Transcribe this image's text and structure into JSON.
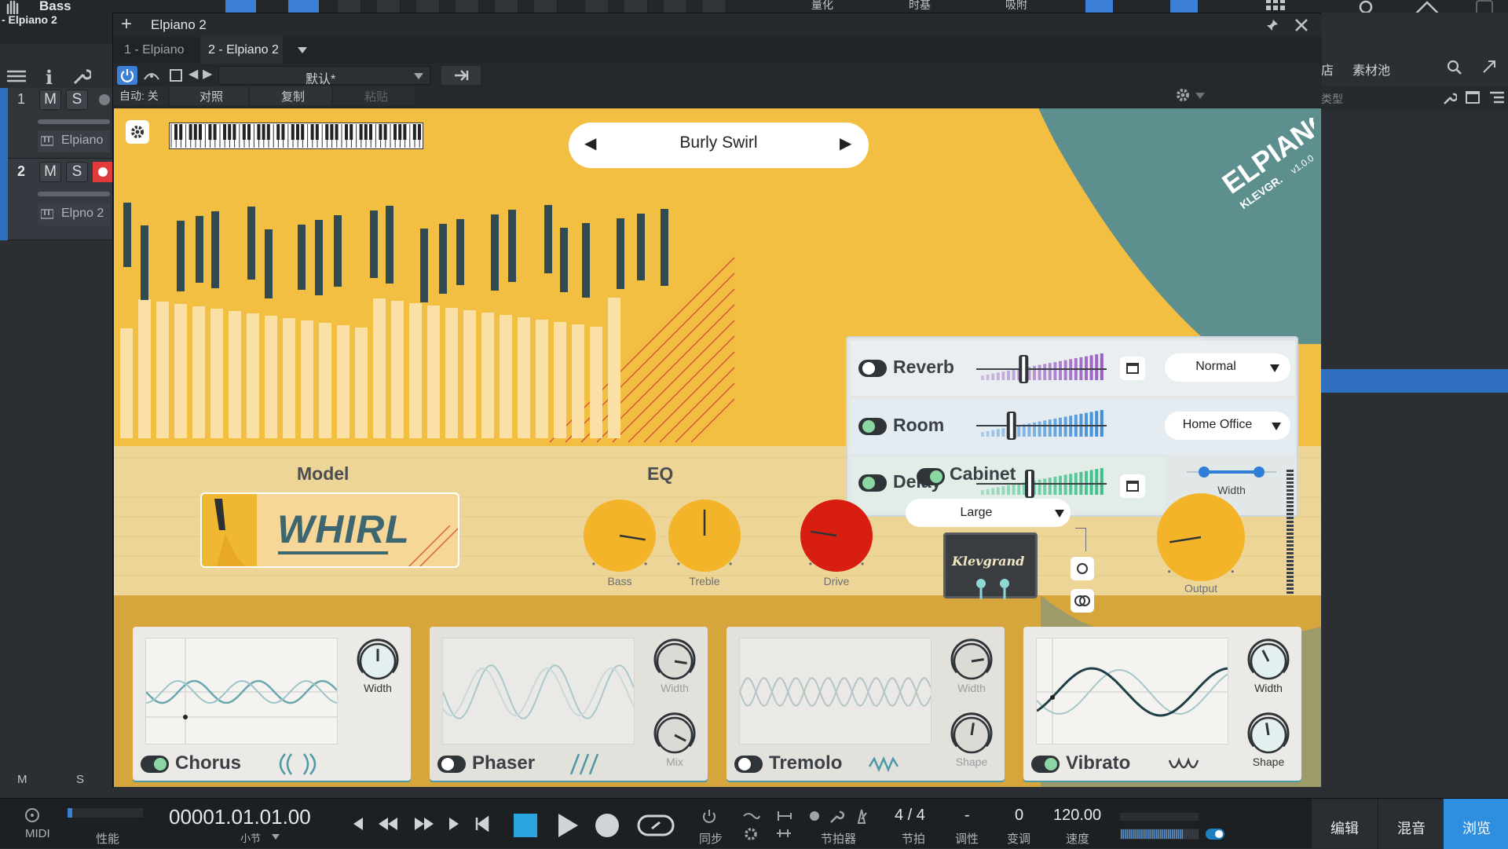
{
  "daw": {
    "left_panel": {
      "track_name_top": "Bass",
      "track_name_sub": "- Elpiano 2",
      "tracks": [
        {
          "number": "1",
          "mute": "M",
          "solo": "S",
          "name": "Elpiano"
        },
        {
          "number": "2",
          "mute": "M",
          "solo": "S",
          "name": "Elpno 2"
        }
      ],
      "footer_m": "M",
      "footer_s": "S"
    },
    "toolbar": {
      "labels": [
        "量化",
        "时基",
        "吸附"
      ]
    },
    "browser": {
      "tabs": [
        "店",
        "素材池"
      ],
      "sub_label": "类型"
    }
  },
  "plugin_window": {
    "title": "Elpiano 2",
    "tabs": [
      "1 - Elpiano",
      "2 - Elpiano 2"
    ],
    "preset": "默认*",
    "auto_label": "自动: 关",
    "compare_label": "对照",
    "copy_label": "复制",
    "paste_label": "粘贴"
  },
  "plugin": {
    "preset_name": "Burly Swirl",
    "logo_text": "ELPIANO",
    "brand": "KLEVGR.",
    "version": "v1.0.0",
    "effects_top": [
      {
        "name": "Reverb",
        "on": true,
        "fader": 0.35,
        "mode": "Normal"
      },
      {
        "name": "Room",
        "on": true,
        "fader": 0.25,
        "mode": "Home Office"
      },
      {
        "name": "Delay",
        "on": true,
        "fader": 0.4,
        "width_label": "Width"
      }
    ],
    "model": {
      "label": "Model",
      "value": "WHIRL"
    },
    "eq": {
      "label": "EQ",
      "bass_label": "Bass",
      "treble_label": "Treble"
    },
    "drive_label": "Drive",
    "cabinet": {
      "label": "Cabinet",
      "on": true,
      "size": "Large",
      "amp_brand": "Klevgrand"
    },
    "output_label": "Output",
    "fx": [
      {
        "name": "Chorus",
        "on": true,
        "knob1": "Width",
        "knob2": ""
      },
      {
        "name": "Phaser",
        "on": false,
        "knob1": "Width",
        "knob2": "Mix"
      },
      {
        "name": "Tremolo",
        "on": false,
        "knob1": "Width",
        "knob2": "Shape"
      },
      {
        "name": "Vibrato",
        "on": true,
        "knob1": "Width",
        "knob2": "Shape"
      }
    ]
  },
  "transport": {
    "midi_label": "MIDI",
    "perf_label": "性能",
    "time": "00001.01.01.00",
    "time_unit": "小节",
    "sync_label": "同步",
    "metronome_label": "节拍器",
    "signature": "4 / 4",
    "signature_label": "节拍",
    "key": "-",
    "key_label": "调性",
    "transpose": "0",
    "transpose_label": "变调",
    "tempo": "120.00",
    "tempo_label": "速度",
    "views": [
      "编辑",
      "混音",
      "浏览"
    ]
  },
  "colors": {
    "plugin_yellow": "#f3bf43",
    "plugin_teal": "#5a8a8c",
    "accent_blue": "#3c7fd6",
    "record_red": "#e03a3a",
    "knob_orange": "#f3b42a",
    "drive_red": "#d81e10"
  }
}
